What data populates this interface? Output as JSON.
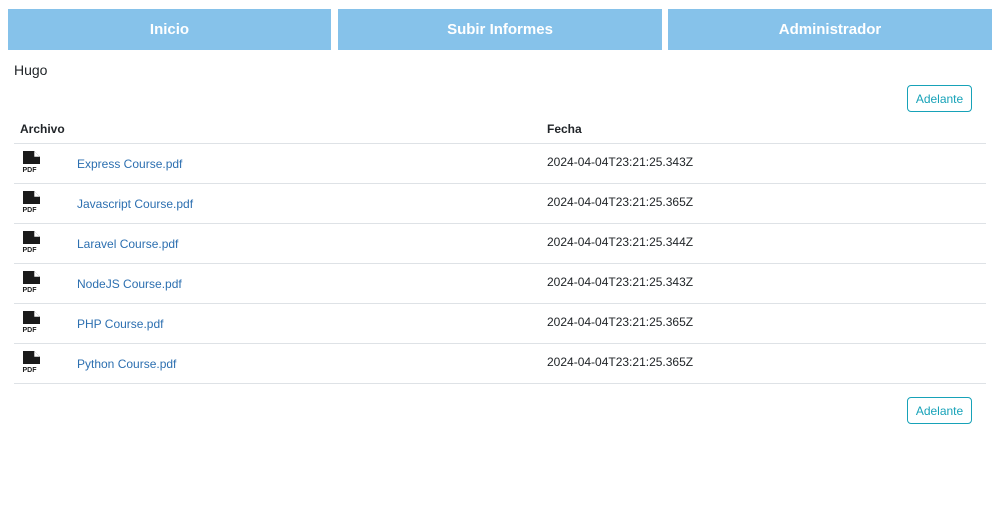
{
  "nav": {
    "tabs": [
      {
        "label": "Inicio"
      },
      {
        "label": "Subir Informes"
      },
      {
        "label": "Administrador"
      }
    ]
  },
  "user": {
    "name": "Hugo"
  },
  "pagination": {
    "next_label": "Adelante"
  },
  "table": {
    "headers": {
      "file": "Archivo",
      "date": "Fecha"
    },
    "rows": [
      {
        "file": "Express Course.pdf",
        "date": "2024-04-04T23:21:25.343Z",
        "icon": "pdf-icon"
      },
      {
        "file": "Javascript Course.pdf",
        "date": "2024-04-04T23:21:25.365Z",
        "icon": "pdf-icon"
      },
      {
        "file": "Laravel Course.pdf",
        "date": "2024-04-04T23:21:25.344Z",
        "icon": "pdf-icon"
      },
      {
        "file": "NodeJS Course.pdf",
        "date": "2024-04-04T23:21:25.343Z",
        "icon": "pdf-icon"
      },
      {
        "file": "PHP Course.pdf",
        "date": "2024-04-04T23:21:25.365Z",
        "icon": "pdf-icon"
      },
      {
        "file": "Python Course.pdf",
        "date": "2024-04-04T23:21:25.365Z",
        "icon": "pdf-icon"
      }
    ]
  },
  "colors": {
    "nav_bg": "#86c2ea",
    "link": "#2c6fb0",
    "button_accent": "#17a2b8"
  }
}
